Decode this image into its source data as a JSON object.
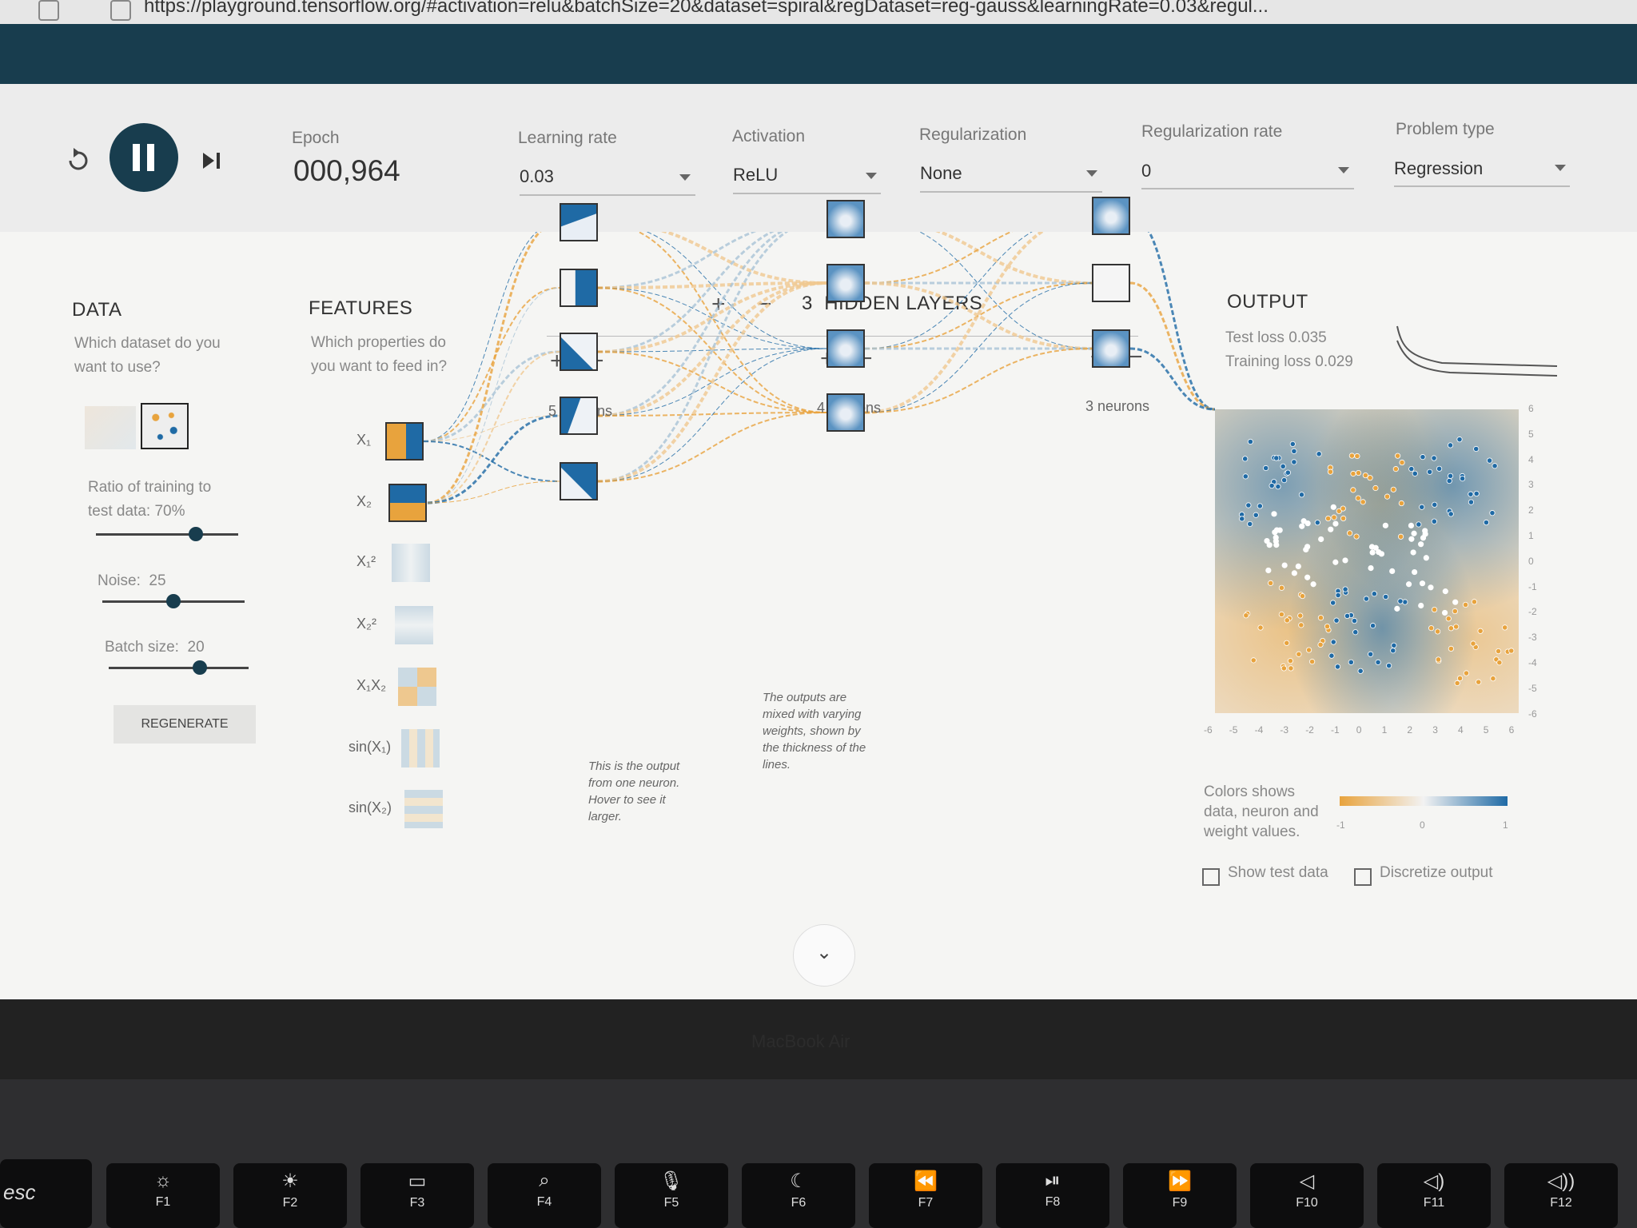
{
  "browser": {
    "url": "https://playground.tensorflow.org/#activation=relu&batchSize=20&dataset=spiral&regDataset=reg-gauss&learningRate=0.03&regul..."
  },
  "controls": {
    "epoch_label": "Epoch",
    "epoch_value": "000,964",
    "learning_rate_label": "Learning rate",
    "learning_rate_value": "0.03",
    "activation_label": "Activation",
    "activation_value": "ReLU",
    "regularization_label": "Regularization",
    "regularization_value": "None",
    "regularization_rate_label": "Regularization rate",
    "regularization_rate_value": "0",
    "problem_type_label": "Problem type",
    "problem_type_value": "Regression"
  },
  "data": {
    "heading": "DATA",
    "question": "Which dataset do you want to use?",
    "ratio_label": "Ratio of training to test data:",
    "ratio_value": "70%",
    "ratio_fraction": 0.7,
    "noise_label": "Noise:",
    "noise_value": "25",
    "noise_fraction": 0.5,
    "batch_label": "Batch size:",
    "batch_value": "20",
    "batch_fraction": 0.65,
    "regenerate": "REGENERATE"
  },
  "features": {
    "heading": "FEATURES",
    "question": "Which properties do you want to feed in?",
    "items": [
      {
        "label": "X₁",
        "active": true
      },
      {
        "label": "X₂",
        "active": true
      },
      {
        "label": "X₁²",
        "active": false
      },
      {
        "label": "X₂²",
        "active": false
      },
      {
        "label": "X₁X₂",
        "active": false
      },
      {
        "label": "sin(X₁)",
        "active": false
      },
      {
        "label": "sin(X₂)",
        "active": false
      }
    ]
  },
  "network": {
    "layer_count": "3",
    "heading": "HIDDEN LAYERS",
    "layers": [
      {
        "label": "5 neurons",
        "neurons": 5
      },
      {
        "label": "4 neurons",
        "neurons": 4
      },
      {
        "label": "3 neurons",
        "neurons": 3
      }
    ],
    "note_neuron": "This is the output from one neuron. Hover to see it larger.",
    "note_weights": "The outputs are mixed with varying weights, shown by the thickness of the lines."
  },
  "output": {
    "heading": "OUTPUT",
    "test_loss": "Test loss 0.035",
    "training_loss": "Training loss 0.029",
    "x_ticks": [
      "-6",
      "-5",
      "-4",
      "-3",
      "-2",
      "-1",
      "0",
      "1",
      "2",
      "3",
      "4",
      "5",
      "6"
    ],
    "y_ticks": [
      "6",
      "5",
      "4",
      "3",
      "2",
      "1",
      "0",
      "-1",
      "-2",
      "-3",
      "-4",
      "-5",
      "-6"
    ],
    "legend_text": "Colors shows data, neuron and weight values.",
    "legend_ticks": [
      "-1",
      "0",
      "1"
    ],
    "show_test_data": "Show test data",
    "discretize_output": "Discretize output",
    "color_negative": "#e8a33d",
    "color_positive": "#1f6aa5"
  },
  "keyboard": {
    "esc": "esc",
    "fkeys": [
      "F1",
      "F2",
      "F3",
      "F4",
      "F5",
      "F6",
      "F7",
      "F8",
      "F9",
      "F10",
      "F11",
      "F12"
    ]
  },
  "bezel_label": "MacBook Air"
}
